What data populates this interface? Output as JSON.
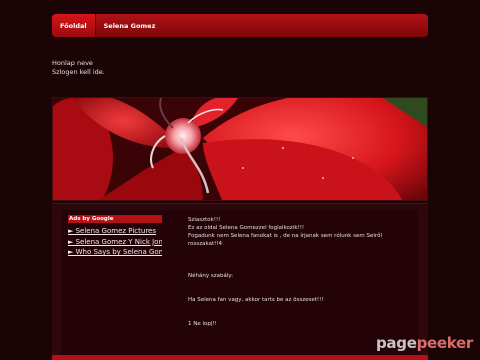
{
  "nav": {
    "items": [
      {
        "label": "Főoldal"
      },
      {
        "label": "Selena Gomez"
      }
    ]
  },
  "site_name": {
    "line1": "Honlap neve",
    "line2": "Szlogen kell ide."
  },
  "sidebar": {
    "ads_title": "Ads by Google",
    "links": [
      {
        "label": "► Selena Gomez Pictures"
      },
      {
        "label": "► Selena Gomez Y Nick Jon"
      },
      {
        "label": "► Who Says by Selena Gom"
      }
    ]
  },
  "main": {
    "p1": "Sziasztok!!!",
    "p2": "Ez az oldal Selena Gomezzel foglalkozik!!!",
    "p3": "Fogadunk nem Selena fanokat is  , de na írjanak sem rólunk sem Selről rosszakat!!4",
    "p4": "Néhány szabály:",
    "p5": "Ha Selena fan vagy, akkor tarts be az összeset!!!",
    "p6": "1 Ne lopj!!"
  },
  "watermark": {
    "part1": "page",
    "part2": "peeker"
  },
  "colors": {
    "background": "#1a0406",
    "accent": "#b01215"
  }
}
